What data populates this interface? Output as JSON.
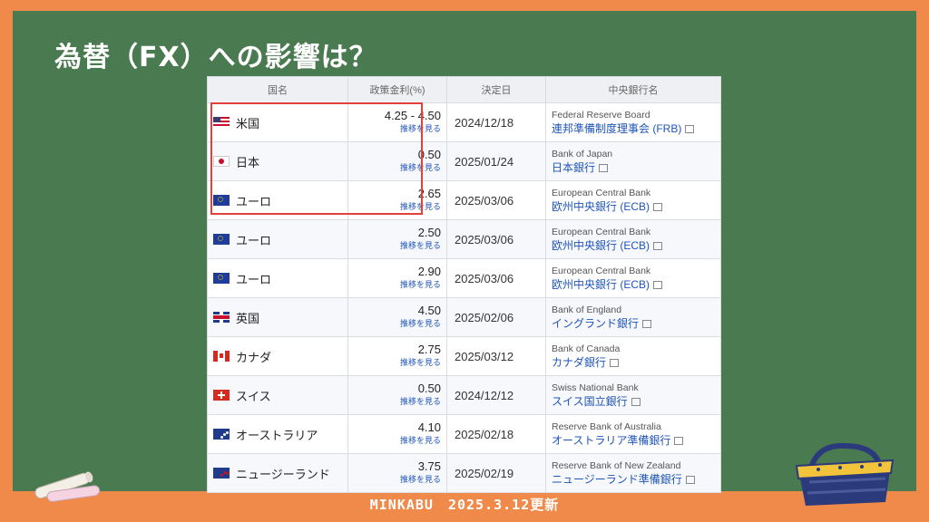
{
  "title": "為替（FX）への影響は？",
  "table": {
    "headers": [
      "国名",
      "政策金利(%)",
      "決定日",
      "中央銀行名"
    ],
    "rows": [
      {
        "flag": "us",
        "country": "米国",
        "rate": "4.25 - 4.50",
        "rate_link": "推移を見る",
        "date": "2024/12/18",
        "bank_en": "Federal Reserve Board",
        "bank_jp": "連邦準備制度理事会 (FRB)"
      },
      {
        "flag": "jp",
        "country": "日本",
        "rate": "0.50",
        "rate_link": "推移を見る",
        "date": "2025/01/24",
        "bank_en": "Bank of Japan",
        "bank_jp": "日本銀行"
      },
      {
        "flag": "eu",
        "country": "ユーロ",
        "rate": "2.65",
        "rate_link": "推移を見る",
        "date": "2025/03/06",
        "bank_en": "European Central Bank",
        "bank_jp": "欧州中央銀行 (ECB)"
      },
      {
        "flag": "eu",
        "country": "ユーロ",
        "rate": "2.50",
        "rate_link": "推移を見る",
        "date": "2025/03/06",
        "bank_en": "European Central Bank",
        "bank_jp": "欧州中央銀行 (ECB)"
      },
      {
        "flag": "eu",
        "country": "ユーロ",
        "rate": "2.90",
        "rate_link": "推移を見る",
        "date": "2025/03/06",
        "bank_en": "European Central Bank",
        "bank_jp": "欧州中央銀行 (ECB)"
      },
      {
        "flag": "gb",
        "country": "英国",
        "rate": "4.50",
        "rate_link": "推移を見る",
        "date": "2025/02/06",
        "bank_en": "Bank of England",
        "bank_jp": "イングランド銀行"
      },
      {
        "flag": "ca",
        "country": "カナダ",
        "rate": "2.75",
        "rate_link": "推移を見る",
        "date": "2025/03/12",
        "bank_en": "Bank of Canada",
        "bank_jp": "カナダ銀行"
      },
      {
        "flag": "ch",
        "country": "スイス",
        "rate": "0.50",
        "rate_link": "推移を見る",
        "date": "2024/12/12",
        "bank_en": "Swiss National Bank",
        "bank_jp": "スイス国立銀行"
      },
      {
        "flag": "au",
        "country": "オーストラリア",
        "rate": "4.10",
        "rate_link": "推移を見る",
        "date": "2025/02/18",
        "bank_en": "Reserve Bank of Australia",
        "bank_jp": "オーストラリア準備銀行"
      },
      {
        "flag": "nz",
        "country": "ニュージーランド",
        "rate": "3.75",
        "rate_link": "推移を見る",
        "date": "2025/02/19",
        "bank_en": "Reserve Bank of New Zealand",
        "bank_jp": "ニュージーランド準備銀行"
      }
    ]
  },
  "footer": "MINKABU　2025.3.12更新",
  "colors": {
    "background": "#f08a4b",
    "board": "#4a7a50",
    "highlight": "#e2403a",
    "link": "#1f55b8"
  },
  "icons": {
    "external": "external-link-icon",
    "chalk": "chalk-icon",
    "basket": "picnic-basket-icon"
  }
}
